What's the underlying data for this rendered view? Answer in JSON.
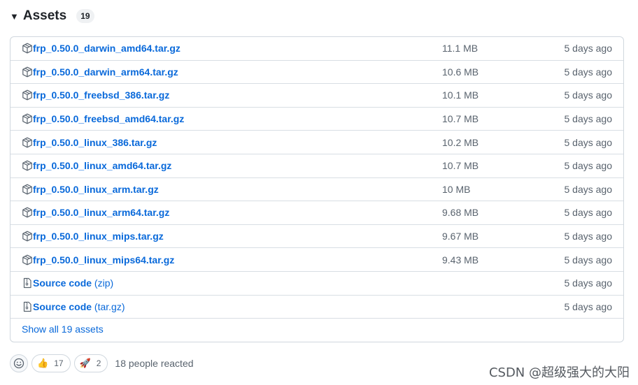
{
  "assets": {
    "title": "Assets",
    "count": "19",
    "rows": [
      {
        "name": "frp_0.50.0_darwin_amd64.tar.gz",
        "size": "11.1 MB",
        "date": "5 days ago"
      },
      {
        "name": "frp_0.50.0_darwin_arm64.tar.gz",
        "size": "10.6 MB",
        "date": "5 days ago"
      },
      {
        "name": "frp_0.50.0_freebsd_386.tar.gz",
        "size": "10.1 MB",
        "date": "5 days ago"
      },
      {
        "name": "frp_0.50.0_freebsd_amd64.tar.gz",
        "size": "10.7 MB",
        "date": "5 days ago"
      },
      {
        "name": "frp_0.50.0_linux_386.tar.gz",
        "size": "10.2 MB",
        "date": "5 days ago"
      },
      {
        "name": "frp_0.50.0_linux_amd64.tar.gz",
        "size": "10.7 MB",
        "date": "5 days ago"
      },
      {
        "name": "frp_0.50.0_linux_arm.tar.gz",
        "size": "10 MB",
        "date": "5 days ago"
      },
      {
        "name": "frp_0.50.0_linux_arm64.tar.gz",
        "size": "9.68 MB",
        "date": "5 days ago"
      },
      {
        "name": "frp_0.50.0_linux_mips.tar.gz",
        "size": "9.67 MB",
        "date": "5 days ago"
      },
      {
        "name": "frp_0.50.0_linux_mips64.tar.gz",
        "size": "9.43 MB",
        "date": "5 days ago"
      }
    ],
    "source_rows": [
      {
        "name": "Source code",
        "format": "(zip)",
        "date": "5 days ago"
      },
      {
        "name": "Source code",
        "format": "(tar.gz)",
        "date": "5 days ago"
      }
    ],
    "show_all": "Show all 19 assets"
  },
  "reactions": {
    "add_icon": "smiley-icon",
    "items": [
      {
        "emoji": "👍",
        "count": "17",
        "icon": "thumbs-up-icon"
      },
      {
        "emoji": "🚀",
        "count": "2",
        "icon": "rocket-icon"
      }
    ],
    "summary": "18 people reacted"
  },
  "watermark": "CSDN @超级强大的大阳",
  "colors": {
    "link": "#0969da",
    "muted": "#59636e",
    "border": "#d0d7de"
  }
}
